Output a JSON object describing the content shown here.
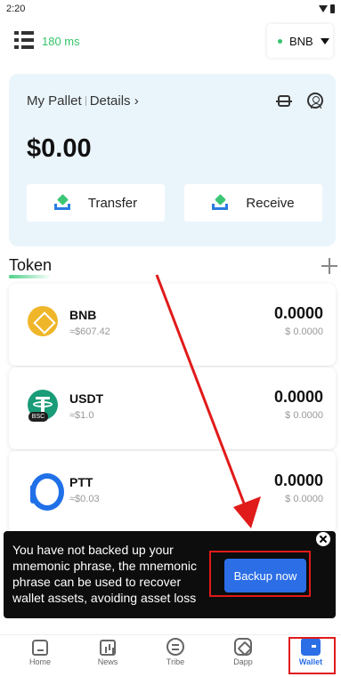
{
  "status_bar": {
    "time": "2:20"
  },
  "header": {
    "latency": "180 ms",
    "network": "BNB"
  },
  "wallet_card": {
    "name": "My Pallet",
    "details_link": "Details ›",
    "balance": "$0.00",
    "transfer_label": "Transfer",
    "receive_label": "Receive"
  },
  "token_section": {
    "title": "Token"
  },
  "tokens": [
    {
      "symbol": "BNB",
      "price": "≈$607.42",
      "amount": "0.0000",
      "value": "$ 0.0000"
    },
    {
      "symbol": "USDT",
      "price": "≈$1.0",
      "amount": "0.0000",
      "value": "$ 0.0000",
      "badge": "BSC"
    },
    {
      "symbol": "PTT",
      "price": "≈$0.03",
      "amount": "0.0000",
      "value": "$ 0.0000"
    }
  ],
  "backup_banner": {
    "message": "You have not backed up your mnemonic phrase, the mnemonic phrase can be used to recover wallet assets, avoiding asset loss",
    "button_label": "Backup now"
  },
  "bottom_nav": {
    "items": [
      {
        "label": "Home",
        "icon": "home-icon"
      },
      {
        "label": "News",
        "icon": "news-icon"
      },
      {
        "label": "Tribe",
        "icon": "tribe-icon"
      },
      {
        "label": "Dapp",
        "icon": "dapp-icon"
      },
      {
        "label": "Wallet",
        "icon": "wallet-icon",
        "active": true
      }
    ]
  },
  "colors": {
    "accent": "#2b6ee6",
    "positive": "#35c46a",
    "annotation": "#e11a1a"
  }
}
